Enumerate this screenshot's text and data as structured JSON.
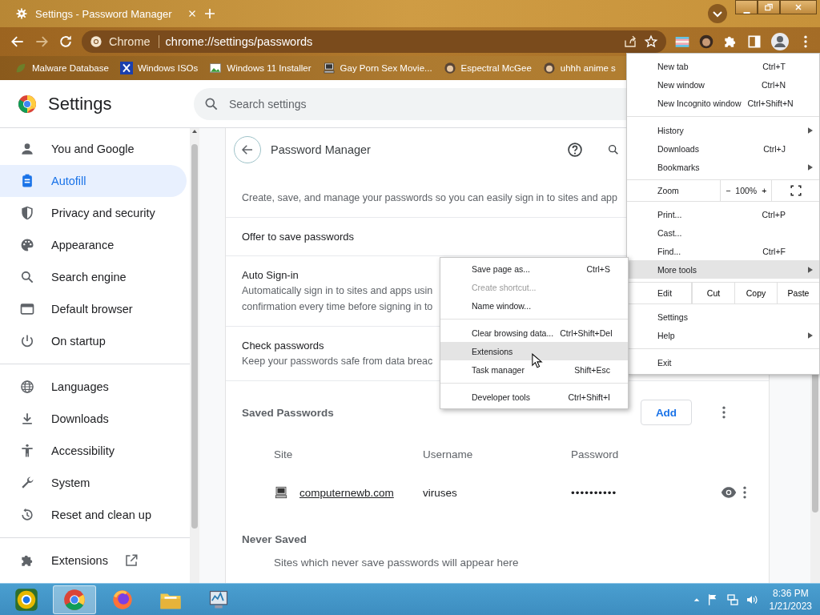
{
  "tab": {
    "title": "Settings - Password Manager"
  },
  "toolbar": {
    "chip": "Chrome",
    "url": "chrome://settings/passwords"
  },
  "bookmarks": [
    {
      "label": "Malware Database",
      "kind": "leaf"
    },
    {
      "label": "Windows ISOs",
      "kind": "x"
    },
    {
      "label": "Windows 11 Installer",
      "kind": "picture"
    },
    {
      "label": "Gay Porn Sex Movie...",
      "kind": "computer"
    },
    {
      "label": "Espectral McGee",
      "kind": "person"
    },
    {
      "label": "uhhh anime s",
      "kind": "person"
    }
  ],
  "settings_header": {
    "title": "Settings",
    "search": {
      "placeholder": "Search settings"
    }
  },
  "sidebar": {
    "groups": [
      [
        {
          "label": "You and Google",
          "selected": false
        },
        {
          "label": "Autofill",
          "selected": true
        },
        {
          "label": "Privacy and security",
          "selected": false
        },
        {
          "label": "Appearance",
          "selected": false
        },
        {
          "label": "Search engine",
          "selected": false
        },
        {
          "label": "Default browser",
          "selected": false
        },
        {
          "label": "On startup",
          "selected": false
        }
      ],
      [
        {
          "label": "Languages",
          "selected": false
        },
        {
          "label": "Downloads",
          "selected": false
        },
        {
          "label": "Accessibility",
          "selected": false
        },
        {
          "label": "System",
          "selected": false
        },
        {
          "label": "Reset and clean up",
          "selected": false
        }
      ],
      [
        {
          "label": "Extensions",
          "selected": false
        }
      ]
    ]
  },
  "page": {
    "title": "Password Manager",
    "description": "Create, save, and manage your passwords so you can easily sign in to sites and app",
    "settings": [
      {
        "title": "Offer to save passwords"
      },
      {
        "title": "Auto Sign-in",
        "lines": [
          "Automatically sign in to sites and apps usin",
          "confirmation every time before signing in to"
        ]
      },
      {
        "title": "Check passwords",
        "lines": [
          "Keep your passwords safe from data breac"
        ]
      }
    ],
    "saved": {
      "heading": "Saved Passwords",
      "add_button": "Add",
      "columns": [
        "Site",
        "Username",
        "Password"
      ],
      "rows": [
        {
          "site": "computernewb.com",
          "username": "viruses",
          "password": "••••••••••"
        }
      ]
    },
    "never_saved": {
      "heading": "Never Saved",
      "text": "Sites which never save passwords will appear here"
    }
  },
  "menu": {
    "items": [
      {
        "kind": "item",
        "label": "New tab",
        "shortcut": "Ctrl+T",
        "submenu": false,
        "selected": false
      },
      {
        "kind": "item",
        "label": "New window",
        "shortcut": "Ctrl+N",
        "submenu": false,
        "selected": false
      },
      {
        "kind": "item",
        "label": "New Incognito window",
        "shortcut": "Ctrl+Shift+N",
        "submenu": false,
        "selected": false
      },
      {
        "kind": "separator"
      },
      {
        "kind": "item",
        "label": "History",
        "submenu": true,
        "selected": false
      },
      {
        "kind": "item",
        "label": "Downloads",
        "shortcut": "Ctrl+J",
        "submenu": false,
        "selected": false
      },
      {
        "kind": "item",
        "label": "Bookmarks",
        "submenu": true,
        "selected": false
      },
      {
        "kind": "zoom",
        "label": "Zoom",
        "minus": "−",
        "value": "100%",
        "plus": "+"
      },
      {
        "kind": "item",
        "label": "Print...",
        "shortcut": "Ctrl+P",
        "submenu": false,
        "selected": false
      },
      {
        "kind": "item",
        "label": "Cast...",
        "submenu": false,
        "selected": false
      },
      {
        "kind": "item",
        "label": "Find...",
        "shortcut": "Ctrl+F",
        "submenu": false,
        "selected": false
      },
      {
        "kind": "item",
        "label": "More tools",
        "submenu": true,
        "selected": true
      },
      {
        "kind": "edit",
        "label": "Edit",
        "buttons": [
          "Cut",
          "Copy",
          "Paste"
        ]
      },
      {
        "kind": "item",
        "label": "Settings",
        "submenu": false,
        "selected": false
      },
      {
        "kind": "item",
        "label": "Help",
        "submenu": true,
        "selected": false
      },
      {
        "kind": "separator"
      },
      {
        "kind": "item",
        "label": "Exit",
        "submenu": false,
        "selected": false
      }
    ]
  },
  "submenu": {
    "items": [
      {
        "kind": "item",
        "label": "Save page as...",
        "shortcut": "Ctrl+S",
        "disabled": false,
        "selected": false
      },
      {
        "kind": "item",
        "label": "Create shortcut...",
        "disabled": true,
        "selected": false
      },
      {
        "kind": "item",
        "label": "Name window...",
        "disabled": false,
        "selected": false
      },
      {
        "kind": "separator"
      },
      {
        "kind": "item",
        "label": "Clear browsing data...",
        "shortcut": "Ctrl+Shift+Del",
        "disabled": false,
        "selected": false
      },
      {
        "kind": "item",
        "label": "Extensions",
        "disabled": false,
        "selected": true
      },
      {
        "kind": "item",
        "label": "Task manager",
        "shortcut": "Shift+Esc",
        "disabled": false,
        "selected": false
      },
      {
        "kind": "separator"
      },
      {
        "kind": "item",
        "label": "Developer tools",
        "shortcut": "Ctrl+Shift+I",
        "disabled": false,
        "selected": false
      }
    ]
  },
  "taskbar": {
    "apps": [
      {
        "selected": false
      },
      {
        "selected": true
      },
      {
        "selected": false
      },
      {
        "selected": false
      },
      {
        "selected": false
      }
    ],
    "time": "8:36 PM",
    "date": "1/21/2023"
  }
}
